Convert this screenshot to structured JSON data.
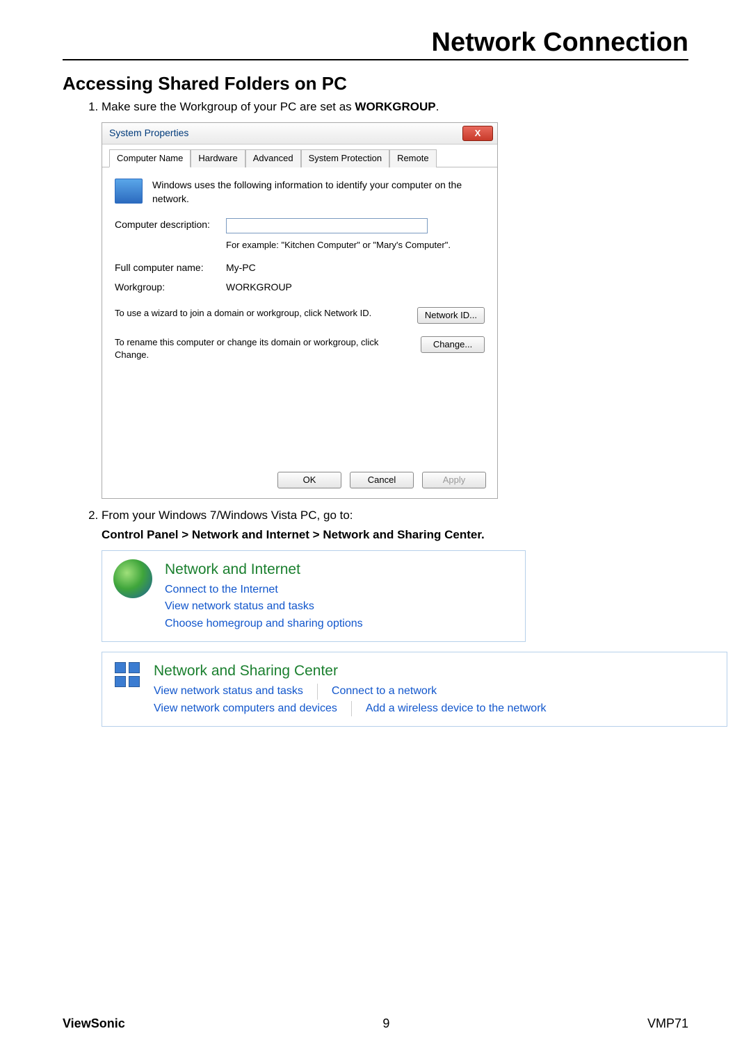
{
  "page": {
    "chapter_title": "Network Connection",
    "section_title": "Accessing Shared Folders on PC",
    "step1_prefix": "Make sure the Workgroup of your PC are set as ",
    "step1_bold": "WORKGROUP",
    "step1_suffix": ".",
    "step2": "From your Windows 7/Windows Vista PC, go to:",
    "path_bold": "Control Panel > Network and Internet > Network and Sharing Center",
    "path_suffix": "."
  },
  "sys_props": {
    "title": "System Properties",
    "close_x": "X",
    "tabs": [
      "Computer Name",
      "Hardware",
      "Advanced",
      "System Protection",
      "Remote"
    ],
    "intro": "Windows uses the following information to identify your computer on the network.",
    "desc_label": "Computer description:",
    "desc_value": "",
    "desc_hint": "For example: \"Kitchen Computer\" or \"Mary's Computer\".",
    "full_name_label": "Full computer name:",
    "full_name_value": "My-PC",
    "workgroup_label": "Workgroup:",
    "workgroup_value": "WORKGROUP",
    "netid_text": "To use a wizard to join a domain or workgroup, click Network ID.",
    "netid_btn": "Network ID...",
    "change_text": "To rename this computer or change its domain or workgroup, click Change.",
    "change_btn": "Change...",
    "ok": "OK",
    "cancel": "Cancel",
    "apply": "Apply"
  },
  "cp1": {
    "heading": "Network and Internet",
    "l1": "Connect to the Internet",
    "l2": "View network status and tasks",
    "l3": "Choose homegroup and sharing options"
  },
  "cp2": {
    "heading": "Network and Sharing Center",
    "l1": "View network status and tasks",
    "l2": "Connect to a network",
    "l3": "View network computers and devices",
    "l4": "Add a wireless device to the network"
  },
  "footer": {
    "brand": "ViewSonic",
    "page": "9",
    "model": "VMP71"
  }
}
